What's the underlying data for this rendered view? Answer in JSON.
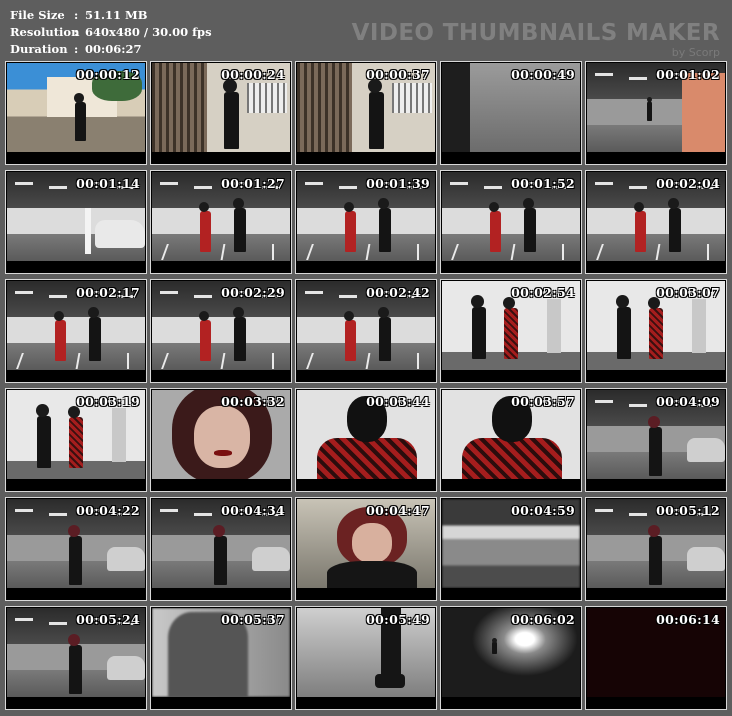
{
  "info": {
    "file_size_label": "File Size",
    "file_size_value": "51.11 MB",
    "resolution_label": "Resolution",
    "resolution_value": "640x480 / 30.00 fps",
    "duration_label": "Duration",
    "duration_value": "00:06:27"
  },
  "brand": {
    "title": "VIDEO THUMBNAILS MAKER",
    "subtitle": "by Scorp"
  },
  "thumbnails": [
    {
      "time": "00:00:12",
      "scene": "street"
    },
    {
      "time": "00:00:24",
      "scene": "gate"
    },
    {
      "time": "00:00:37",
      "scene": "gate"
    },
    {
      "time": "00:00:49",
      "scene": "floor"
    },
    {
      "time": "00:01:02",
      "scene": "garage-wide"
    },
    {
      "time": "00:01:14",
      "scene": "garage-car"
    },
    {
      "time": "00:01:27",
      "scene": "fight"
    },
    {
      "time": "00:01:39",
      "scene": "fight"
    },
    {
      "time": "00:01:52",
      "scene": "fight"
    },
    {
      "time": "00:02:04",
      "scene": "fight"
    },
    {
      "time": "00:02:17",
      "scene": "fight"
    },
    {
      "time": "00:02:29",
      "scene": "fight"
    },
    {
      "time": "00:02:42",
      "scene": "fight"
    },
    {
      "time": "00:02:54",
      "scene": "wall-kick"
    },
    {
      "time": "00:03:07",
      "scene": "wall-kick"
    },
    {
      "time": "00:03:19",
      "scene": "wall-kick"
    },
    {
      "time": "00:03:32",
      "scene": "face"
    },
    {
      "time": "00:03:44",
      "scene": "masked"
    },
    {
      "time": "00:03:57",
      "scene": "masked"
    },
    {
      "time": "00:04:09",
      "scene": "garage-woman"
    },
    {
      "time": "00:04:22",
      "scene": "garage-woman"
    },
    {
      "time": "00:04:34",
      "scene": "garage-woman"
    },
    {
      "time": "00:04:47",
      "scene": "face-low"
    },
    {
      "time": "00:04:59",
      "scene": "blur"
    },
    {
      "time": "00:05:12",
      "scene": "garage-woman"
    },
    {
      "time": "00:05:24",
      "scene": "garage-woman"
    },
    {
      "time": "00:05:37",
      "scene": "blur-coat"
    },
    {
      "time": "00:05:49",
      "scene": "boots"
    },
    {
      "time": "00:06:02",
      "scene": "tunnel"
    },
    {
      "time": "00:06:14",
      "scene": "dark"
    }
  ],
  "colors": {
    "background": "#5e5e5e",
    "cell_border": "#d8d8d8",
    "brand_text": "#808080",
    "info_text": "#ffffff"
  }
}
